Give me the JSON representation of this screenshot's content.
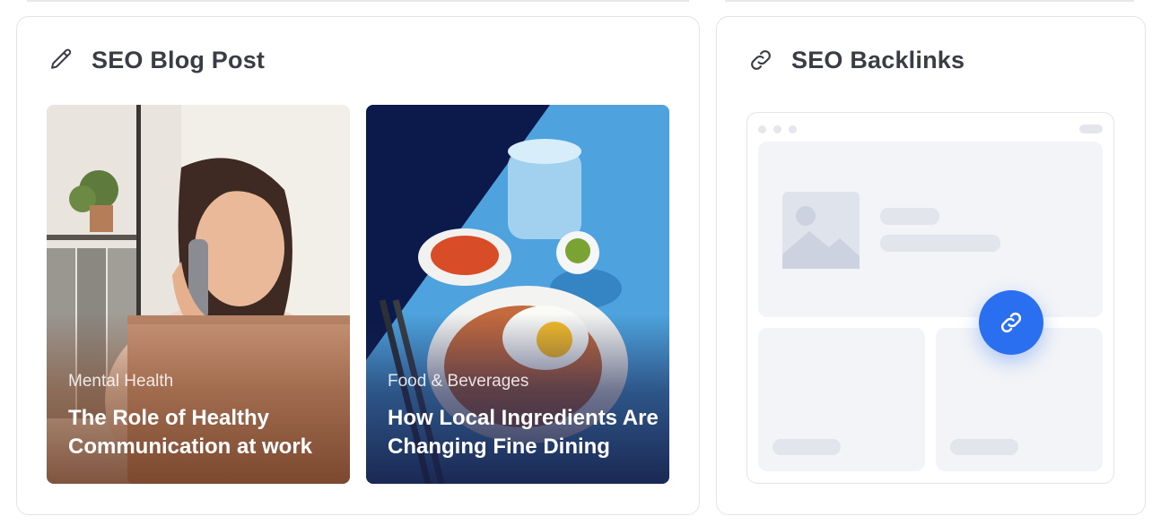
{
  "blog_card": {
    "title": "SEO Blog Post",
    "icon": "pencil-icon",
    "posts": [
      {
        "category": "Mental Health",
        "title_line1": "The Role of Healthy",
        "title_line2": "Communication at work"
      },
      {
        "category": "Food & Beverages",
        "title_line1": "How Local Ingredients Are",
        "title_line2": "Changing Fine Dining"
      }
    ]
  },
  "backlinks_card": {
    "title": "SEO Backlinks",
    "icon": "link-icon",
    "button_icon": "link-icon"
  },
  "colors": {
    "accent": "#2a6ff0",
    "title_text": "#3b3d44",
    "card_border": "#e2e4ea"
  }
}
